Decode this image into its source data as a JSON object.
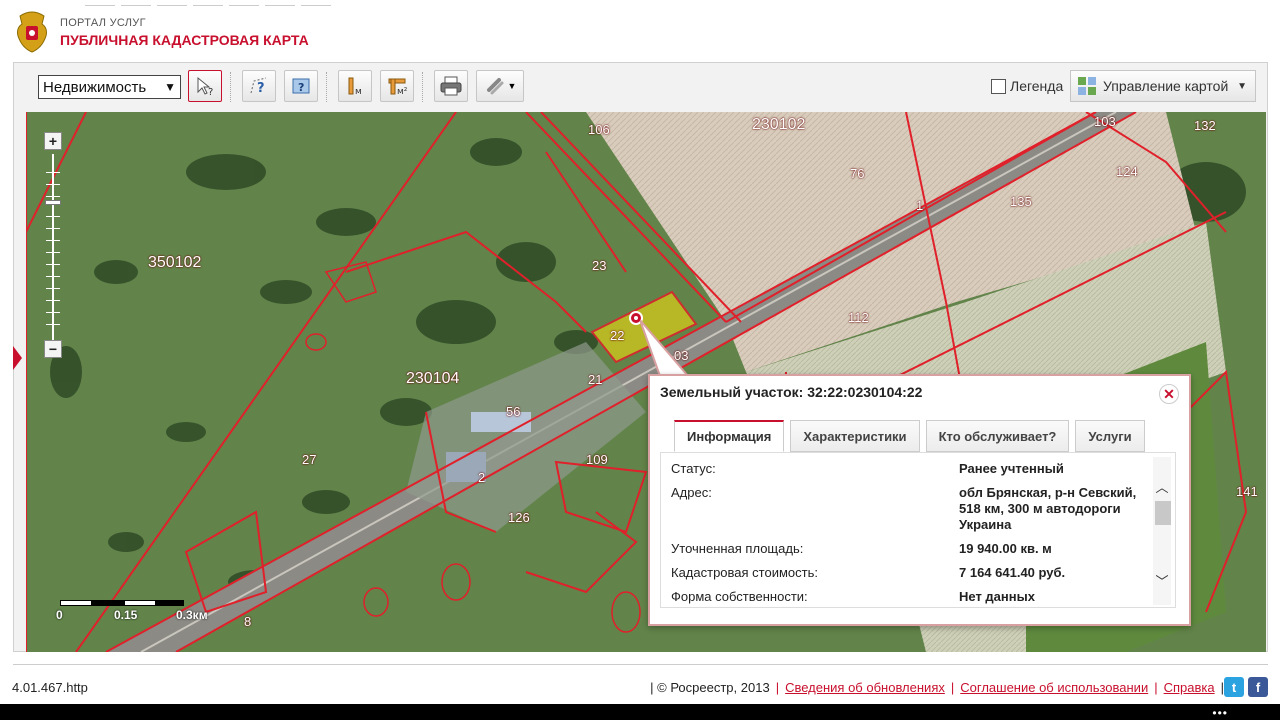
{
  "header": {
    "portal_small": "ПОРТАЛ УСЛУГ",
    "portal_big": "ПУБЛИЧНАЯ КАДАСТРОВАЯ КАРТА"
  },
  "toolbar": {
    "layer_select": "Недвижимость",
    "legend_label": "Легенда",
    "map_control_label": "Управление картой"
  },
  "map": {
    "parcel_labels": [
      "350102",
      "230104",
      "230102",
      "106",
      "76",
      "1",
      "135",
      "103",
      "124",
      "132",
      "23",
      "22",
      "03",
      "21",
      "56",
      "27",
      "2",
      "109",
      "126",
      "112",
      "8",
      "141"
    ],
    "scale": {
      "l0": "0",
      "l1": "0.15",
      "l2": "0.3км"
    }
  },
  "popup": {
    "title": "Земельный участок: 32:22:0230104:22",
    "tabs": [
      "Информация",
      "Характеристики",
      "Кто обслуживает?",
      "Услуги"
    ],
    "rows": [
      {
        "key": "Статус:",
        "value": "Ранее учтенный"
      },
      {
        "key": "Адрес:",
        "value": "обл Брянская, р-н Севский, 518 км, 300 м автодороги Украина"
      },
      {
        "key": "Уточненная площадь:",
        "value": "19 940.00 кв. м"
      },
      {
        "key": "Кадастровая стоимость:",
        "value": "7 164 641.40 руб."
      },
      {
        "key": "Форма собственности:",
        "value": "Нет данных"
      }
    ]
  },
  "footer": {
    "version": "4.01.467.http",
    "copyright": "| © Росреестр, 2013",
    "link_updates": "Сведения об обновлениях",
    "link_agreement": "Соглашение об использовании",
    "link_help": "Справка",
    "sep": "|"
  },
  "colors": {
    "accent": "#c8102e",
    "parcel_border": "#e0202a",
    "selected_parcel": "#c8c020"
  }
}
